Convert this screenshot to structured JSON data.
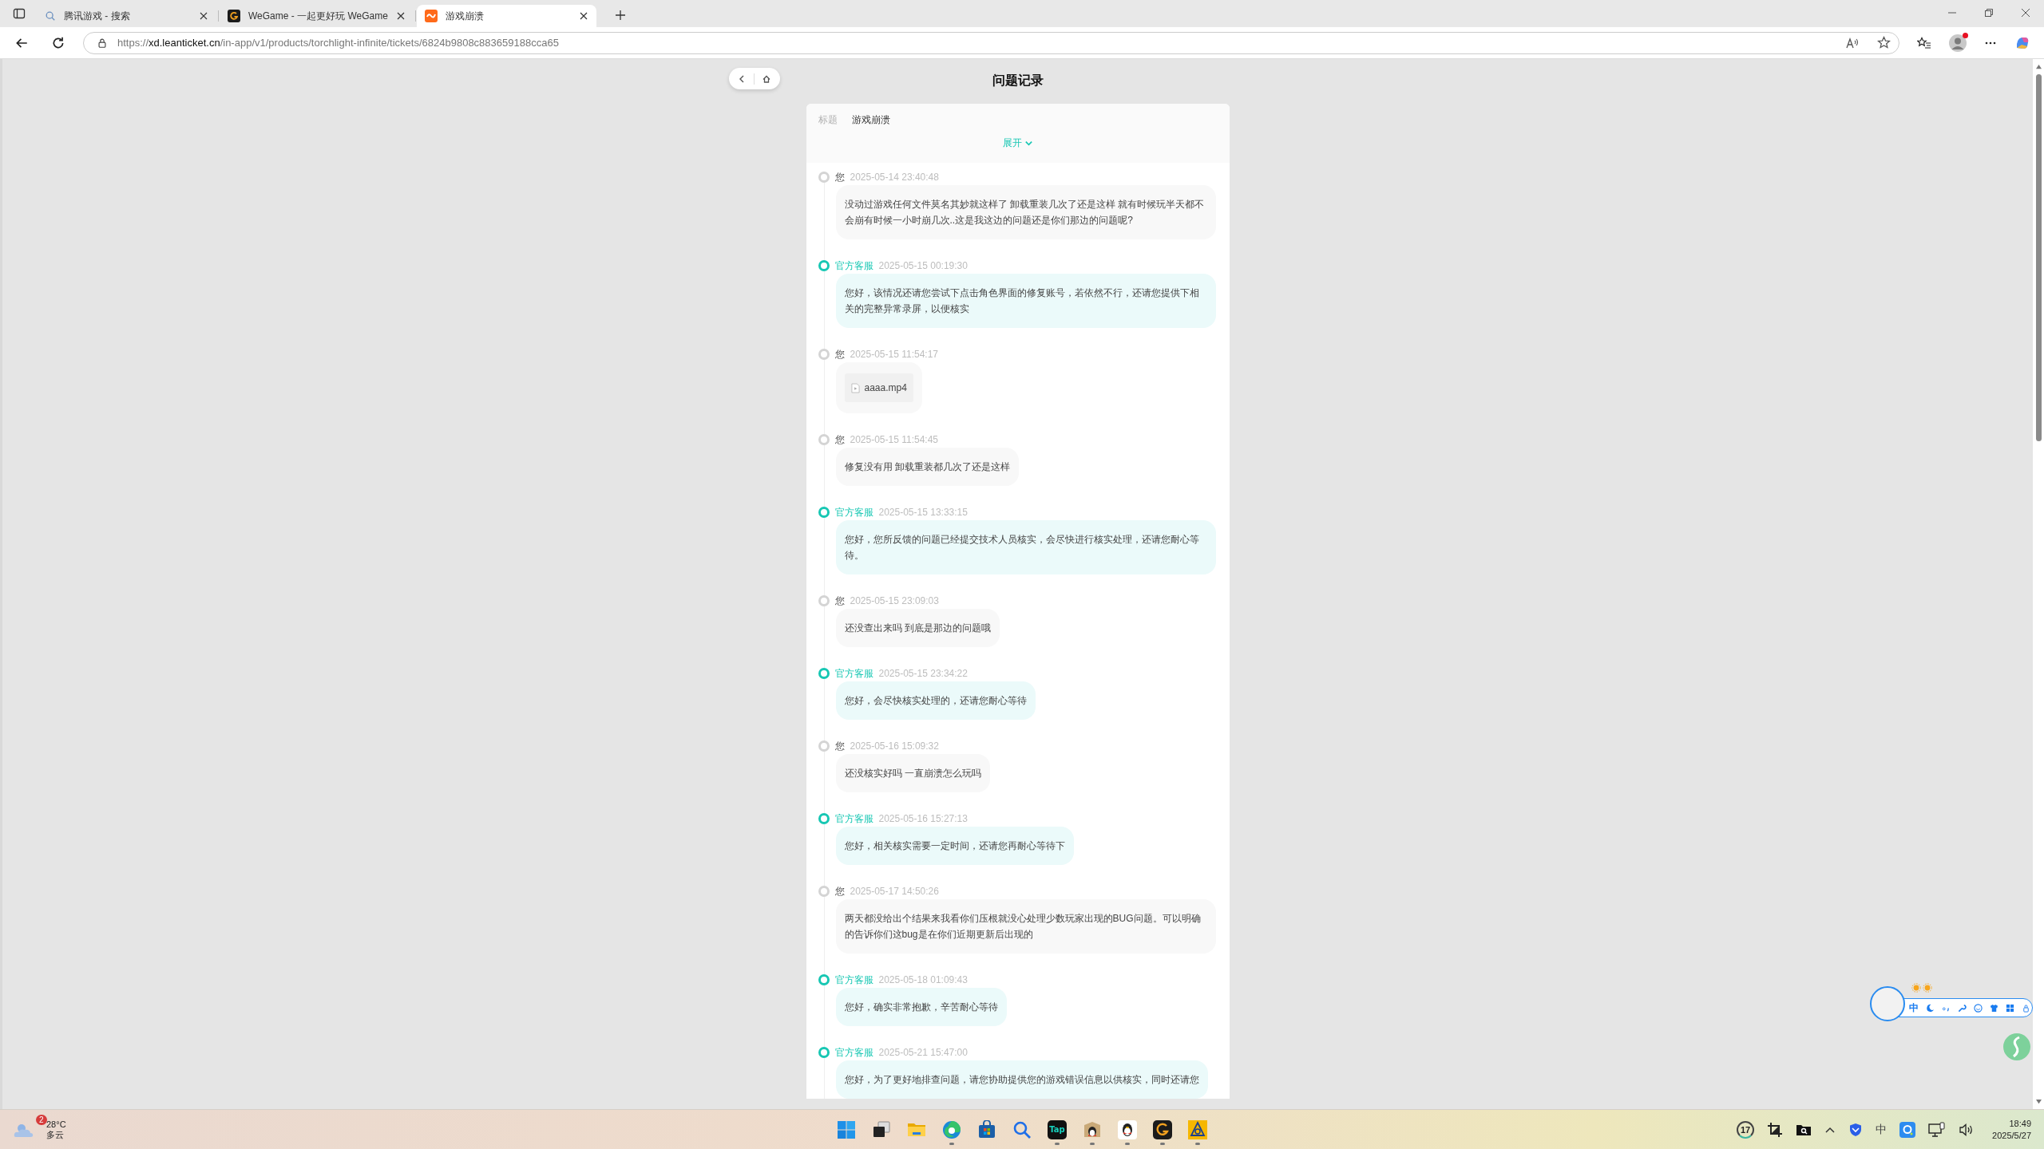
{
  "browser": {
    "tabs": [
      {
        "title": "腾讯游戏 - 搜索",
        "kind": "search",
        "selected": false
      },
      {
        "title": "WeGame - 一起更好玩 WeGame",
        "kind": "wegame",
        "selected": false
      },
      {
        "title": "游戏崩溃",
        "kind": "ticket",
        "selected": true
      }
    ],
    "url": "https://**xd.leanticket.cn**/in-app/v1/products/torchlight-infinite/tickets/6824b9808c883659188cca65",
    "profile_notification": true
  },
  "page": {
    "title": "问题记录",
    "ticket": {
      "title_label": "标题",
      "title_value": "游戏崩溃",
      "expand_label": "展开",
      "expanded": false
    },
    "messages": [
      {
        "kind": "user",
        "author": "您",
        "time": "2025-05-14 23:40:48",
        "text": "没动过游戏任何文件莫名其妙就这样了 卸载重装几次了还是这样 就有时候玩半天都不会崩有时候一小时崩几次..这是我这边的问题还是你们那边的问题呢?"
      },
      {
        "kind": "agent",
        "author": "官方客服",
        "time": "2025-05-15 00:19:30",
        "text": "您好，该情况还请您尝试下点击角色界面的修复账号，若依然不行，还请您提供下相关的完整异常录屏，以便核实"
      },
      {
        "kind": "user",
        "author": "您",
        "time": "2025-05-15 11:54:17",
        "attachment": "aaaa.mp4"
      },
      {
        "kind": "user",
        "author": "您",
        "time": "2025-05-15 11:54:45",
        "text": "修复没有用 卸载重装都几次了还是这样"
      },
      {
        "kind": "agent",
        "author": "官方客服",
        "time": "2025-05-15 13:33:15",
        "text": "您好，您所反馈的问题已经提交技术人员核实，会尽快进行核实处理，还请您耐心等待。"
      },
      {
        "kind": "user",
        "author": "您",
        "time": "2025-05-15 23:09:03",
        "text": "还没查出来吗 到底是那边的问题哦"
      },
      {
        "kind": "agent",
        "author": "官方客服",
        "time": "2025-05-15 23:34:22",
        "text": "您好，会尽快核实处理的，还请您耐心等待"
      },
      {
        "kind": "user",
        "author": "您",
        "time": "2025-05-16 15:09:32",
        "text": "还没核实好吗 一直崩溃怎么玩吗"
      },
      {
        "kind": "agent",
        "author": "官方客服",
        "time": "2025-05-16 15:27:13",
        "text": "您好，相关核实需要一定时间，还请您再耐心等待下"
      },
      {
        "kind": "user",
        "author": "您",
        "time": "2025-05-17 14:50:26",
        "text": "两天都没给出个结果来我看你们压根就没心处理少数玩家出现的BUG问题。可以明确的告诉你们这bug是在你们近期更新后出现的"
      },
      {
        "kind": "agent",
        "author": "官方客服",
        "time": "2025-05-18 01:09:43",
        "text": "您好，确实非常抱歉，辛苦耐心等待"
      },
      {
        "kind": "agent",
        "author": "官方客服",
        "time": "2025-05-21 15:47:00",
        "text": "您好，为了更好地排查问题，请您协助提供您的游戏错误信息以供核实，同时还请您"
      }
    ]
  },
  "ime_toolbar": {
    "mode": "中"
  },
  "taskbar": {
    "weather": {
      "badge": "2",
      "temperature": "28°C",
      "condition": "多云"
    },
    "apps": [
      {
        "kind": "windows",
        "running": false
      },
      {
        "kind": "taskview",
        "running": false
      },
      {
        "kind": "folder",
        "running": false
      },
      {
        "kind": "edge",
        "running": true
      },
      {
        "kind": "store",
        "running": false
      },
      {
        "kind": "search",
        "running": false
      },
      {
        "kind": "tap",
        "label": "Tap",
        "running": true
      },
      {
        "kind": "penguin-box",
        "running": true
      },
      {
        "kind": "penguin",
        "running": true
      },
      {
        "kind": "wegame",
        "running": true
      },
      {
        "kind": "game",
        "running": true
      }
    ],
    "tray": {
      "badge": "17",
      "input_mode": "中",
      "time": "18:49",
      "date": "2025/5/27"
    }
  }
}
